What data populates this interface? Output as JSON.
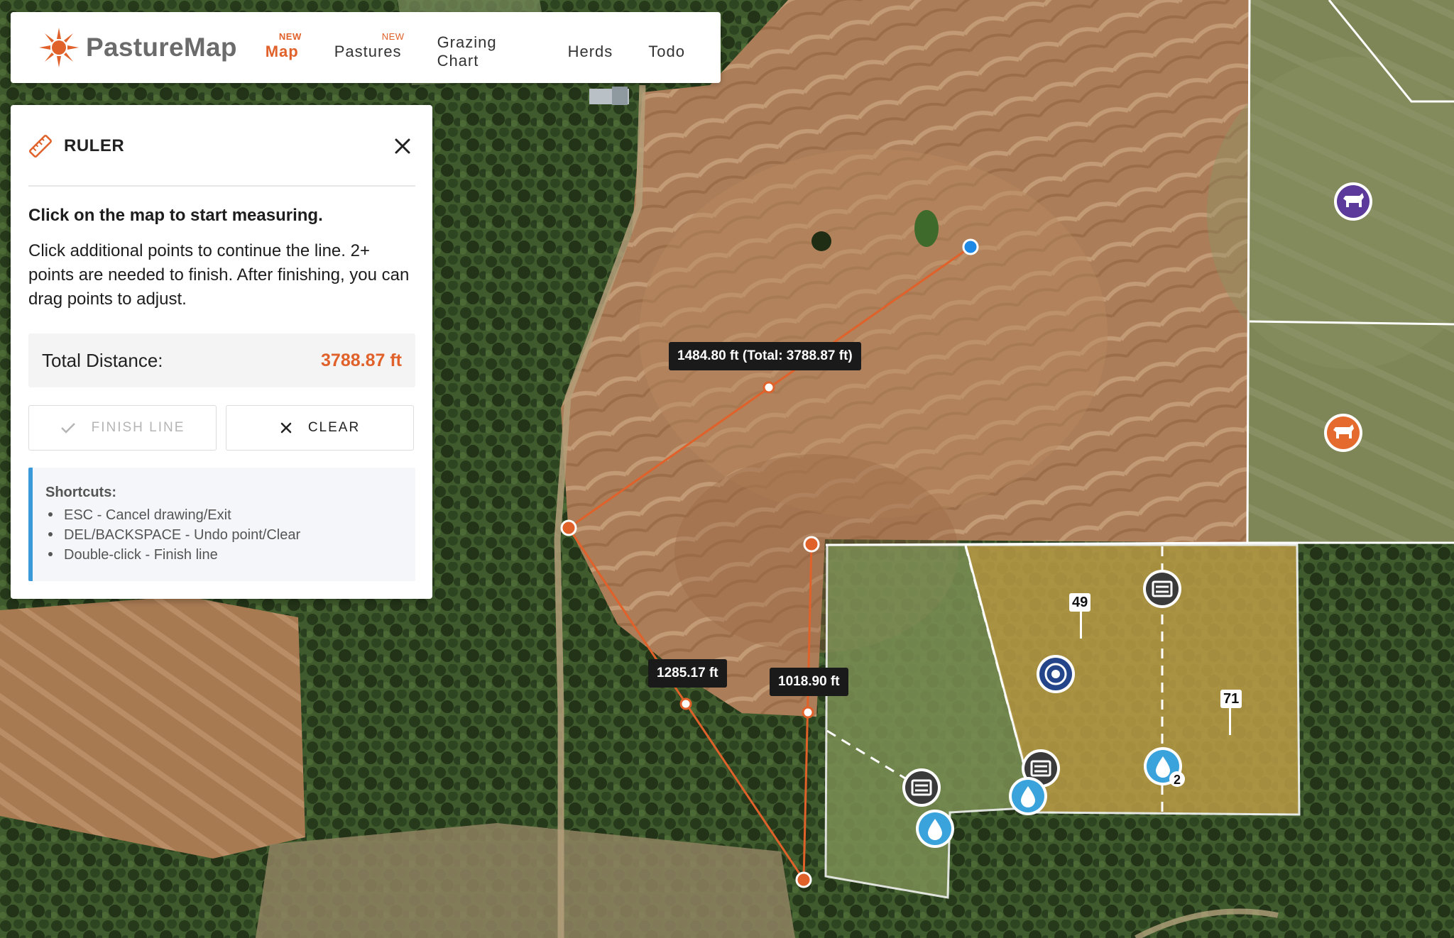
{
  "app": {
    "name": "PastureMap",
    "brand_color": "#e0612a"
  },
  "nav": {
    "items": [
      {
        "label": "Map",
        "badge": "NEW",
        "active": true
      },
      {
        "label": "Pastures",
        "badge": "NEW",
        "active": false
      },
      {
        "label": "Grazing Chart",
        "badge": "",
        "active": false
      },
      {
        "label": "Herds",
        "badge": "",
        "active": false
      },
      {
        "label": "Todo",
        "badge": "",
        "active": false
      }
    ]
  },
  "ruler": {
    "title": "RULER",
    "icon": "ruler-icon",
    "heading": "Click on the map to start measuring.",
    "body": "Click additional points to continue the line. 2+ points are needed to finish. After finishing, you can drag points to adjust.",
    "total_label": "Total Distance:",
    "total_value": "3788.87 ft",
    "finish_label": "FINISH LINE",
    "clear_label": "CLEAR",
    "shortcuts_title": "Shortcuts:",
    "shortcuts": [
      "ESC - Cancel drawing/Exit",
      "DEL/BACKSPACE - Undo point/Clear",
      "Double-click - Finish line"
    ]
  },
  "measurements": {
    "seg_top": "1484.80 ft (Total: 3788.87 ft)",
    "seg_left": "1285.17 ft",
    "seg_right": "1018.90 ft"
  },
  "paddocks": {
    "label_a": "49",
    "label_b": "71",
    "water_count": "2"
  },
  "colors": {
    "measure_line": "#e0612a",
    "start_point": "#1e88e5",
    "herd_purple": "#5b3a9b",
    "herd_orange": "#e56a2e",
    "water_blue": "#3aa3dc",
    "target_navy": "#24458a",
    "feeder_dark": "#3a3a3a",
    "paddock_gold": "#b89a45",
    "paddock_green": "#7c8f55"
  }
}
